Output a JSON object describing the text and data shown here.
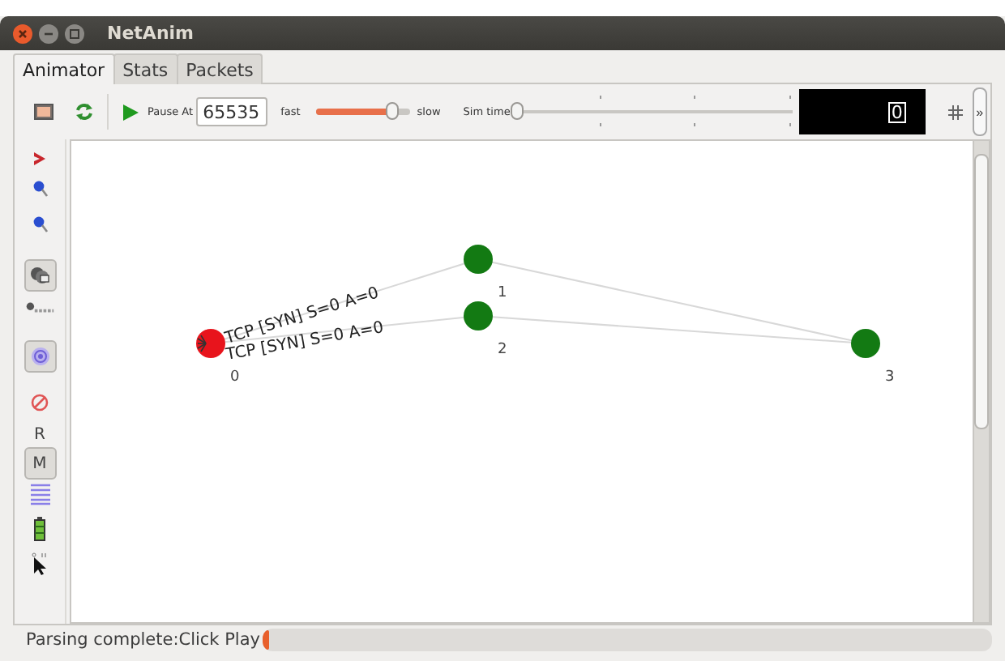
{
  "window": {
    "title": "NetAnim"
  },
  "tabs": [
    {
      "label": "Animator",
      "selected": true
    },
    {
      "label": "Stats",
      "selected": false
    },
    {
      "label": "Packets",
      "selected": false
    }
  ],
  "toolbar": {
    "pause_label": "Pause At",
    "pause_value": "65535",
    "speed": {
      "min_label": "fast",
      "max_label": "slow",
      "level": 0.8
    },
    "sim_time": {
      "label": "Sim time",
      "level": 0
    },
    "time_display": "0",
    "more": "»"
  },
  "tools": [
    {
      "kind": "chevron",
      "pressed": false
    },
    {
      "kind": "zoom-in",
      "pressed": false
    },
    {
      "kind": "zoom-out",
      "pressed": false
    },
    {
      "kind": "nodes",
      "pressed": true
    },
    {
      "kind": "tag",
      "pressed": false
    },
    {
      "kind": "target",
      "pressed": true
    },
    {
      "kind": "prohibited",
      "pressed": false
    },
    {
      "kind": "text",
      "label": "R",
      "pressed": false
    },
    {
      "kind": "text",
      "label": "M",
      "pressed": true
    },
    {
      "kind": "list",
      "pressed": false
    },
    {
      "kind": "battery",
      "pressed": false
    },
    {
      "kind": "pointer",
      "pressed": false
    }
  ],
  "network": {
    "nodes": [
      {
        "label": "0",
        "color": "#e8141c"
      },
      {
        "label": "1",
        "color": "#137a13"
      },
      {
        "label": "2",
        "color": "#137a13"
      },
      {
        "label": "3",
        "color": "#137a13"
      }
    ],
    "packets": [
      "TCP [SYN] S=0 A=0",
      "TCP [SYN] S=0 A=0"
    ]
  },
  "status": {
    "message": "Parsing complete:Click Play",
    "progress": {
      "level": 0.01
    }
  }
}
